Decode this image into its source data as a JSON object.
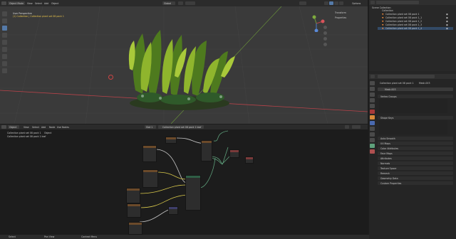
{
  "topbar": {
    "editor_mode": "Object Mode",
    "menus": [
      "View",
      "Select",
      "Add",
      "Object"
    ],
    "orientation": "Global",
    "shading": "Options"
  },
  "viewport": {
    "view_label": "User Perspective",
    "collection_label": "(1) Collection | Collection plant set 08 pack 1",
    "nav_labels": [
      "Transform",
      "Properties"
    ]
  },
  "node_editor": {
    "header_items": [
      "Object",
      "View",
      "Select",
      "Add",
      "Node",
      "Use Nodes"
    ],
    "slot": "Slot 1",
    "material_name": "Collection plant set 08 pack 1 leaf",
    "breadcrumb": [
      "Collection plant set 08 pack 1",
      "Object",
      "Collection plant set 08 pack 1 leaf"
    ]
  },
  "outliner": {
    "title": "Scene Collection",
    "items": [
      "Collection",
      "Collection plant set 08 pack 1",
      "Collection plant set 08 pack 1_1",
      "Collection plant set 08 pack 1_2",
      "Collection plant set 08 pack 1_3",
      "Collection plant set 08 pack 1_4"
    ]
  },
  "properties": {
    "object_path": "Collection plant set 08 pack 1",
    "mesh_name": "Mesh.003",
    "data_name": "Mesh.003",
    "sections_top": [
      "Vertex Groups",
      "Shape Keys"
    ],
    "sections": [
      "UV Maps",
      "Color Attributes",
      "Face Maps",
      "Attributes",
      "Normals",
      "Texture Space",
      "Remesh",
      "Geometry Data",
      "Custom Properties"
    ],
    "sections_extra": [
      "Auto Smooth"
    ]
  },
  "statusbar": {
    "items": [
      "Select",
      "Pan View",
      "Context Menu"
    ]
  },
  "colors": {
    "accent_orange": "#e8863a",
    "panel_bg": "#2b2b2b",
    "viewport_bg": "#3a3a3a",
    "node_bg": "#1c1c1c",
    "axis_red": "#b8434a",
    "axis_green": "#6e9a3a"
  }
}
